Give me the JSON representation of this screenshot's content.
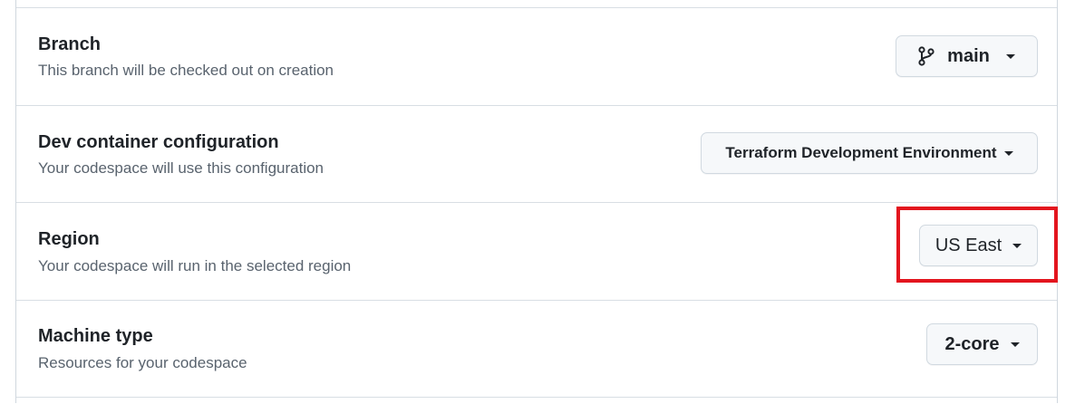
{
  "rows": [
    {
      "title": "Branch",
      "description": "This branch will be checked out on creation",
      "control": {
        "label": "main",
        "icon": "git-branch-icon"
      }
    },
    {
      "title": "Dev container configuration",
      "description": "Your codespace will use this configuration",
      "control": {
        "label": "Terraform Development Environment"
      }
    },
    {
      "title": "Region",
      "description": "Your codespace will run in the selected region",
      "control": {
        "label": "US East"
      }
    },
    {
      "title": "Machine type",
      "description": "Resources for your codespace",
      "control": {
        "label": "2-core"
      }
    }
  ],
  "colors": {
    "highlight": "#e3151e",
    "button_bg": "#f6f8fa",
    "border": "#d0d7de"
  }
}
